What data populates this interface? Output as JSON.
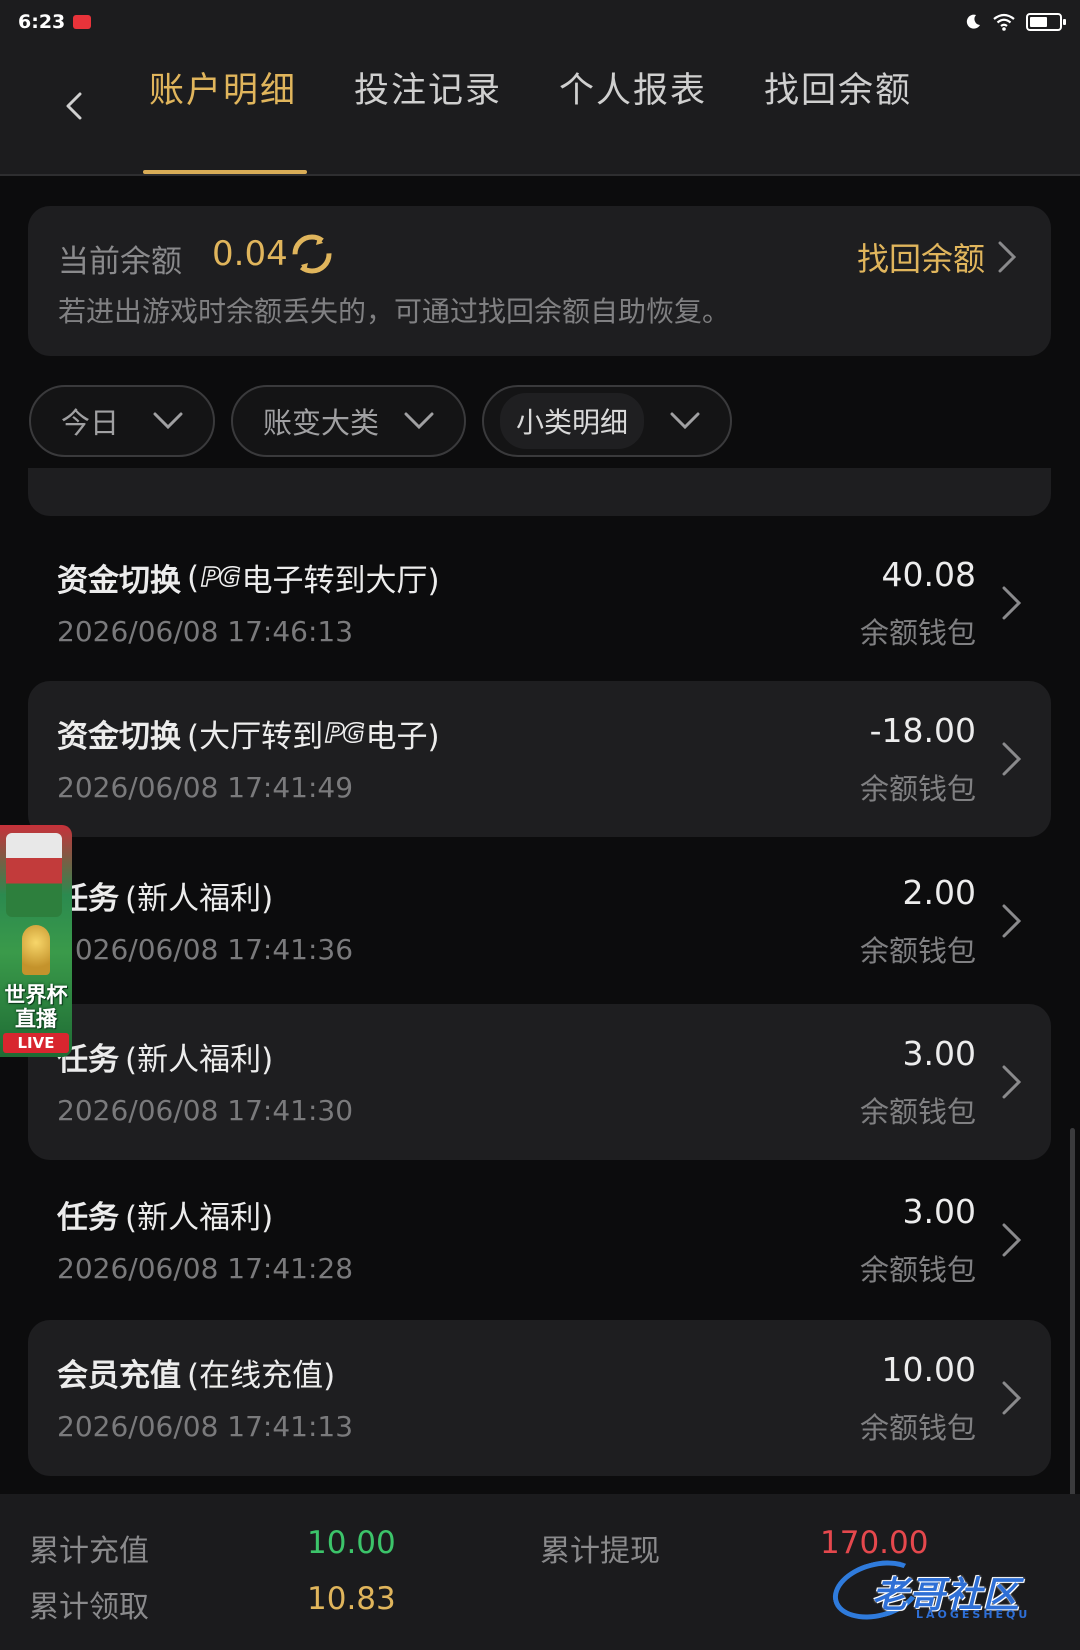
{
  "status_bar": {
    "time": "6:23"
  },
  "tabs": [
    {
      "label": "账户明细",
      "active": true
    },
    {
      "label": "投注记录",
      "active": false
    },
    {
      "label": "个人报表",
      "active": false
    },
    {
      "label": "找回余额",
      "active": false
    }
  ],
  "balance": {
    "label": "当前余额",
    "value": "0.04",
    "recover_label": "找回余额",
    "hint": "若进出游戏时余额丢失的，可通过找回余额自助恢复。"
  },
  "filters": {
    "date": "今日",
    "category": "账变大类",
    "subcategory": "小类明细"
  },
  "records": [
    {
      "title_main": "资金切换",
      "title_sub_pre": "(",
      "title_sub_mid1": "",
      "logo": "PG",
      "title_sub_mid2": "电子转到大厅)",
      "time": "2026/06/08 17:46:13",
      "amount": "40.08",
      "wallet": "余额钱包"
    },
    {
      "title_main": "资金切换",
      "title_sub_pre": "(大厅转到",
      "logo": "PG",
      "title_sub_mid2": "电子)",
      "time": "2026/06/08 17:41:49",
      "amount": "-18.00",
      "wallet": "余额钱包"
    },
    {
      "title_main": "任务",
      "title_sub": "(新人福利)",
      "time": "2026/06/08 17:41:36",
      "amount": "2.00",
      "wallet": "余额钱包"
    },
    {
      "title_main": "任务",
      "title_sub": "(新人福利)",
      "time": "2026/06/08 17:41:30",
      "amount": "3.00",
      "wallet": "余额钱包"
    },
    {
      "title_main": "任务",
      "title_sub": "(新人福利)",
      "time": "2026/06/08 17:41:28",
      "amount": "3.00",
      "wallet": "余额钱包"
    },
    {
      "title_main": "会员充值",
      "title_sub": "(在线充值)",
      "time": "2026/06/08 17:41:13",
      "amount": "10.00",
      "wallet": "余额钱包"
    }
  ],
  "live_badge": {
    "line1": "世界杯",
    "line2": "直播",
    "tag": "LIVE"
  },
  "summary": {
    "deposit_label": "累计充值",
    "deposit_value": "10.00",
    "withdraw_label": "累计提现",
    "withdraw_value": "170.00",
    "claim_label": "累计领取",
    "claim_value": "10.83"
  },
  "watermark": {
    "text": "老哥社区",
    "sub": "LAOGESHEQU"
  },
  "colors": {
    "accent": "#e0b55c",
    "green": "#3cc46a",
    "red": "#e5484d",
    "bg": "#0c0c0d",
    "card": "#1e1e20"
  },
  "battery_level": 0.62
}
